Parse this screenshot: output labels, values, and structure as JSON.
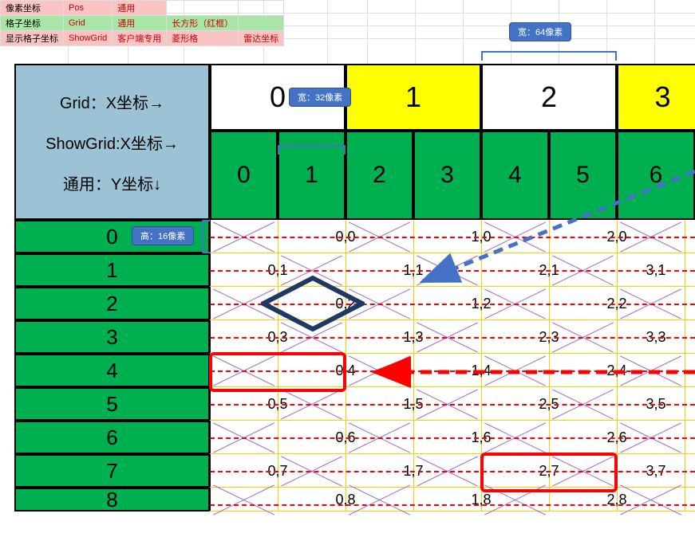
{
  "legend": {
    "rows": [
      {
        "c0": "像素坐标",
        "c1": "Pos",
        "c2": "通用",
        "c3": "",
        "c4": ""
      },
      {
        "c0": "格子坐标",
        "c1": "Grid",
        "c2": "通用",
        "c3": "长方形（红框）",
        "c4": ""
      },
      {
        "c0": "显示格子坐标",
        "c1": "ShowGrid",
        "c2": "客户端专用",
        "c3": "菱形格",
        "c4": "雷达坐标"
      }
    ]
  },
  "callouts": {
    "width64": "宽：64像素",
    "width32": "宽：32像素",
    "height16": "高：16像素"
  },
  "header": {
    "line1": "Grid：X坐标→",
    "line2": "ShowGrid:X坐标→",
    "line3": "通用：Y坐标↓"
  },
  "gridX": [
    "0",
    "1",
    "2",
    "3"
  ],
  "showGridX": [
    "0",
    "1",
    "2",
    "3",
    "4",
    "5",
    "6"
  ],
  "yLabels": [
    "0",
    "1",
    "2",
    "3",
    "4",
    "5",
    "6",
    "7",
    "8"
  ],
  "cells": {
    "r0": [
      "0,0",
      "1,0",
      "2,0"
    ],
    "r1": [
      "0,1",
      "1,1",
      "2,1",
      "3,1"
    ],
    "r2": [
      "0,2",
      "1,2",
      "2,2"
    ],
    "r3": [
      "0,3",
      "1,3",
      "2,3",
      "3,3"
    ],
    "r4": [
      "0,4",
      "1,4",
      "2,4"
    ],
    "r5": [
      "0,5",
      "1,5",
      "2,5",
      "3,5"
    ],
    "r6": [
      "0,6",
      "1,6",
      "2,6"
    ],
    "r7": [
      "0,7",
      "1,7",
      "2,7",
      "3,7"
    ],
    "r8": [
      "0,8",
      "1,8",
      "2,8"
    ]
  },
  "colors": {
    "greenHeader": "#00b050",
    "blueHeader": "#9cc3d5",
    "yellow": "#ffff00",
    "callout": "#4472c4",
    "red": "#ff0000",
    "diamond": "#1f3864"
  }
}
